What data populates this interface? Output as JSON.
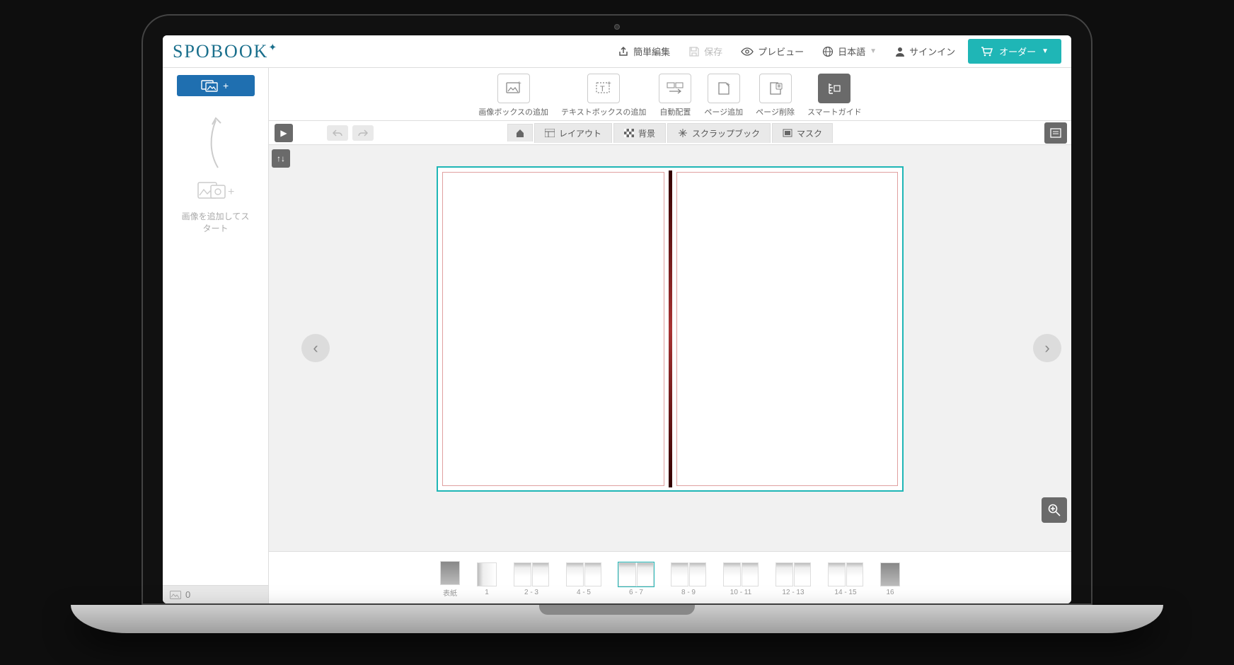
{
  "app": {
    "logo": "SPOBOOK"
  },
  "header": {
    "easy_edit": "簡単編集",
    "save": "保存",
    "preview": "プレビュー",
    "language": "日本語",
    "signin": "サインイン",
    "order": "オーダー"
  },
  "toolbar": {
    "add_image_box": "画像ボックスの追加",
    "add_text_box": "テキストボックスの追加",
    "auto_layout": "自動配置",
    "add_page": "ページ追加",
    "delete_page": "ページ削除",
    "smart_guide": "スマートガイド"
  },
  "tabs": {
    "layout": "レイアウト",
    "background": "背景",
    "scrapbook": "スクラップブック",
    "mask": "マスク"
  },
  "sidebar": {
    "prompt_line1": "画像を追加してス",
    "prompt_line2": "タート",
    "image_count": "0"
  },
  "pages": {
    "thumbs": [
      {
        "label": "表紙",
        "type": "single-dark"
      },
      {
        "label": "1",
        "type": "single"
      },
      {
        "label": "2 - 3",
        "type": "spread"
      },
      {
        "label": "4 - 5",
        "type": "spread"
      },
      {
        "label": "6 - 7",
        "type": "spread",
        "active": true
      },
      {
        "label": "8 - 9",
        "type": "spread"
      },
      {
        "label": "10 - 11",
        "type": "spread"
      },
      {
        "label": "12 - 13",
        "type": "spread"
      },
      {
        "label": "14 - 15",
        "type": "spread"
      },
      {
        "label": "16",
        "type": "single-dark"
      }
    ]
  }
}
